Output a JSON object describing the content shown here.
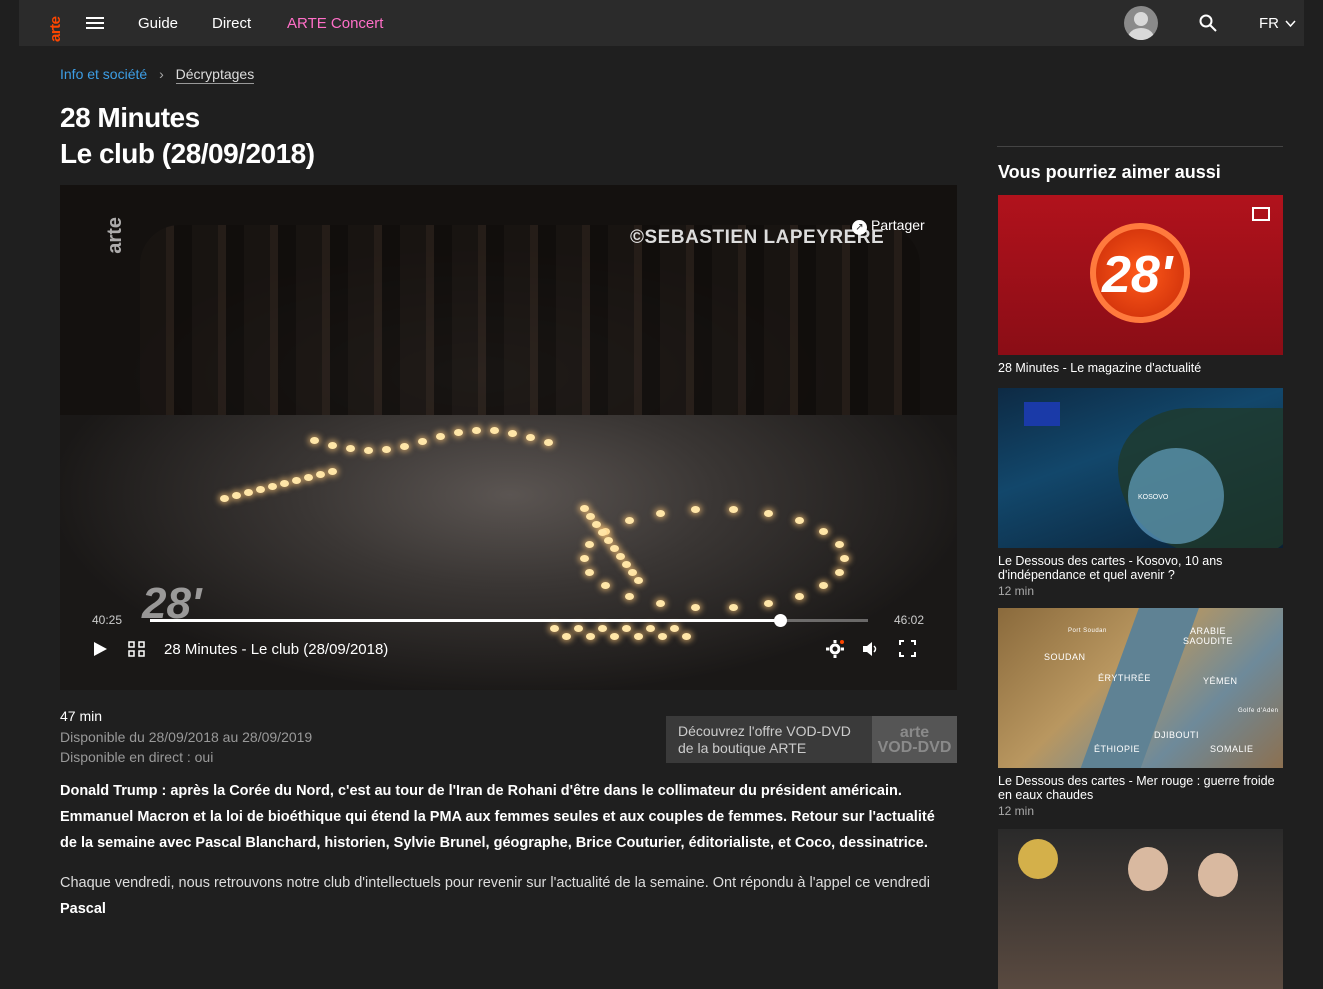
{
  "header": {
    "logo": "arte",
    "nav": [
      "Guide",
      "Direct",
      "ARTE Concert"
    ],
    "language": "FR"
  },
  "breadcrumb": {
    "parent": "Info et société",
    "current": "Décryptages"
  },
  "page": {
    "title_line1": "28 Minutes",
    "title_line2": "Le club (28/09/2018)"
  },
  "player": {
    "watermark": "©SEBASTIEN LAPEYRERE",
    "arte_watermark": "arte",
    "share_label": "Partager",
    "logo_text": "28'",
    "time_elapsed": "40:25",
    "time_total": "46:02",
    "progress_fraction": 0.878,
    "title": "28 Minutes - Le club (28/09/2018)"
  },
  "meta": {
    "duration": "47 min",
    "availability": "Disponible du 28/09/2018 au 28/09/2019",
    "live": "Disponible en direct : oui"
  },
  "vod": {
    "text": "Découvrez l'offre VOD-DVD de la boutique ARTE",
    "logo_line1": "arte",
    "logo_line2": "VOD-DVD"
  },
  "description": {
    "lead": "Donald Trump : après la Corée du Nord, c'est au tour de l'Iran de Rohani d'être dans le collimateur du président américain. Emmanuel Macron et la loi de bioéthique qui étend la PMA aux femmes seules et aux couples de femmes. Retour sur l'actualité de la semaine avec Pascal Blanchard, historien, Sylvie Brunel, géographe, Brice Couturier, éditorialiste, et Coco, dessinatrice.",
    "body": "Chaque vendredi, nous retrouvons notre club d'intellectuels pour revenir sur l'actualité de la semaine. Ont répondu à l'appel ce vendredi",
    "body_bold": "Pascal"
  },
  "sidebar": {
    "heading": "Vous pourriez aimer aussi",
    "cards": [
      {
        "title": "28 Minutes - Le magazine d'actualité",
        "duration": "",
        "thumb_text": "28'"
      },
      {
        "title": "Le Dessous des cartes - Kosovo, 10 ans d'indépendance et quel avenir ?",
        "duration": "12 min",
        "thumb_text": "KOSOVO"
      },
      {
        "title": "Le Dessous des cartes - Mer rouge : guerre froide en eaux chaudes",
        "duration": "12 min",
        "thumb_labels": [
          "SOUDAN",
          "ÉRYTHRÉE",
          "ARABIE SAOUDITE",
          "YÉMEN",
          "DJIBOUTI",
          "ÉTHIOPIE",
          "SOMALIE",
          "Port Soudan",
          "Golfe d'Aden"
        ]
      },
      {
        "title": "",
        "duration": ""
      }
    ]
  },
  "colors": {
    "background": "#1f1f1f",
    "topbar": "#2b2b2b",
    "arte_orange": "#fd4600",
    "concert_pink": "#ff6fc8",
    "link_blue": "#3d9ee5"
  }
}
